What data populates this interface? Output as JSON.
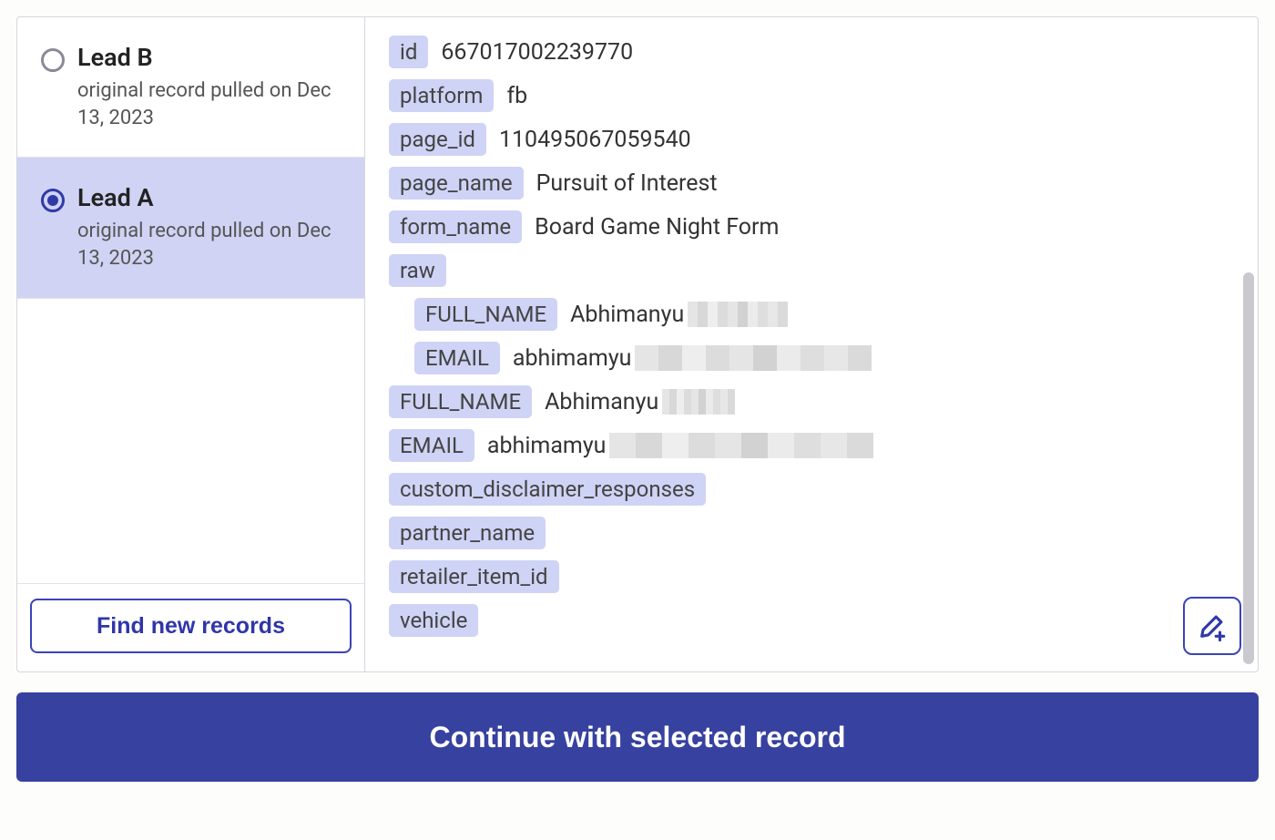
{
  "sidebar": {
    "leads": [
      {
        "title": "Lead B",
        "sub": "original record pulled on Dec 13, 2023",
        "selected": false
      },
      {
        "title": "Lead A",
        "sub": "original record pulled on Dec 13, 2023",
        "selected": true
      }
    ],
    "find_label": "Find new records"
  },
  "detail": {
    "fields": {
      "id": {
        "key": "id",
        "value": "667017002239770"
      },
      "platform": {
        "key": "platform",
        "value": "fb"
      },
      "page_id": {
        "key": "page_id",
        "value": "110495067059540"
      },
      "page_name": {
        "key": "page_name",
        "value": "Pursuit of Interest"
      },
      "form_name": {
        "key": "form_name",
        "value": "Board Game Night Form"
      },
      "raw": {
        "key": "raw"
      },
      "raw_full_name": {
        "key": "FULL_NAME",
        "value": "Abhimanyu"
      },
      "raw_email": {
        "key": "EMAIL",
        "value": "abhimamyu"
      },
      "full_name": {
        "key": "FULL_NAME",
        "value": "Abhimanyu"
      },
      "email": {
        "key": "EMAIL",
        "value": "abhimamyu"
      },
      "custom_disclaimer_responses": {
        "key": "custom_disclaimer_responses"
      },
      "partner_name": {
        "key": "partner_name"
      },
      "retailer_item_id": {
        "key": "retailer_item_id"
      },
      "vehicle": {
        "key": "vehicle"
      }
    }
  },
  "cta_label": "Continue with selected record"
}
